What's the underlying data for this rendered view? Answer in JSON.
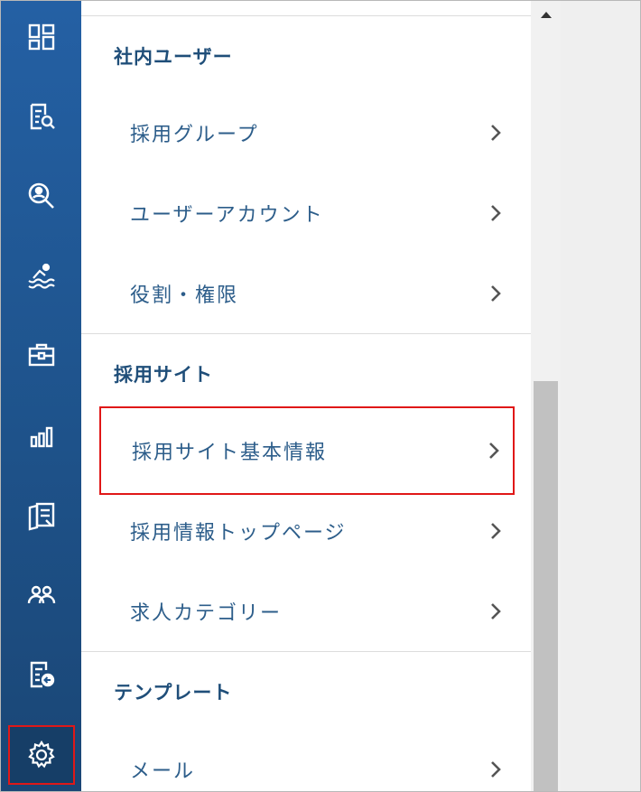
{
  "sidebar": {
    "icons": [
      "dashboard-icon",
      "document-search-icon",
      "candidate-search-icon",
      "swimmer-icon",
      "briefcase-icon",
      "bar-chart-icon",
      "report-icon",
      "users-icon",
      "document-export-icon",
      "gear-icon"
    ],
    "active": "gear-icon"
  },
  "menu": {
    "sections": [
      {
        "title": "社内ユーザー",
        "items": [
          "採用グループ",
          "ユーザーアカウント",
          "役割・権限"
        ]
      },
      {
        "title": "採用サイト",
        "items": [
          "採用サイト基本情報",
          "採用情報トップページ",
          "求人カテゴリー"
        ]
      },
      {
        "title": "テンプレート",
        "items": [
          "メール"
        ]
      }
    ],
    "highlighted_item": "採用サイト基本情報"
  },
  "colors": {
    "sidebar": "#2460a4",
    "section_title": "#1f4e79",
    "item_text": "#2c5d8a",
    "highlight": "#e01818"
  }
}
